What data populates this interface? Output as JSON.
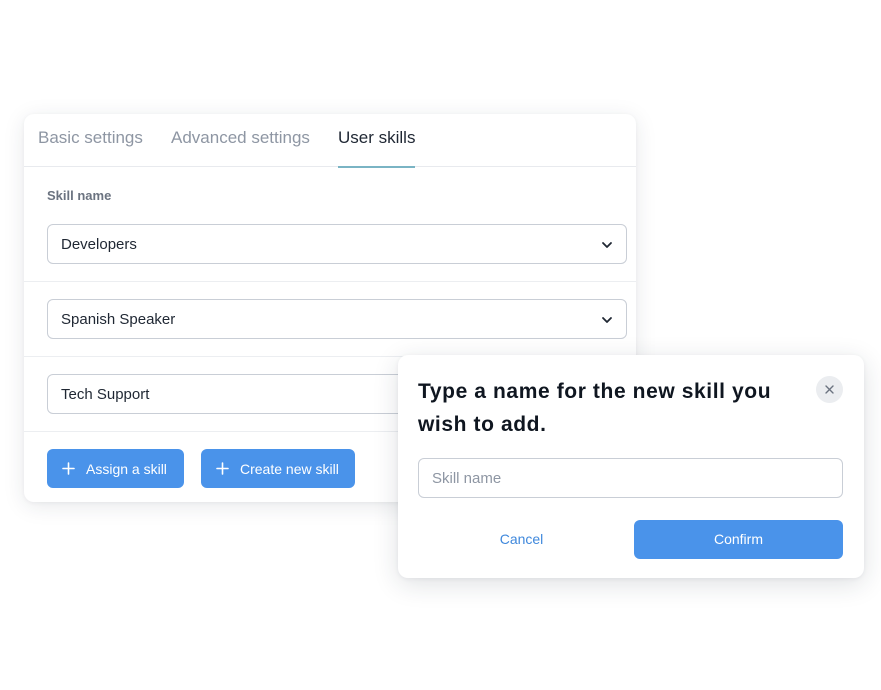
{
  "tabs": [
    {
      "label": "Basic settings"
    },
    {
      "label": "Advanced settings"
    },
    {
      "label": "User skills",
      "active": true
    }
  ],
  "form": {
    "field_label": "Skill name",
    "skills": [
      {
        "value": "Developers"
      },
      {
        "value": "Spanish Speaker"
      },
      {
        "value": "Tech Support"
      }
    ]
  },
  "actions": {
    "assign_label": "Assign a skill",
    "create_label": "Create new skill"
  },
  "modal": {
    "title": "Type a name for the new skill you wish to add.",
    "input_placeholder": "Skill name",
    "input_value": "",
    "cancel_label": "Cancel",
    "confirm_label": "Confirm"
  },
  "icons": {
    "select_arrow": "chevron-down-icon",
    "button_icon": "plus-icon",
    "modal_close": "close-icon"
  },
  "colors": {
    "accent": "#4a93ea",
    "tab_underline": "#7ab4c4",
    "link": "#3f88dc"
  }
}
